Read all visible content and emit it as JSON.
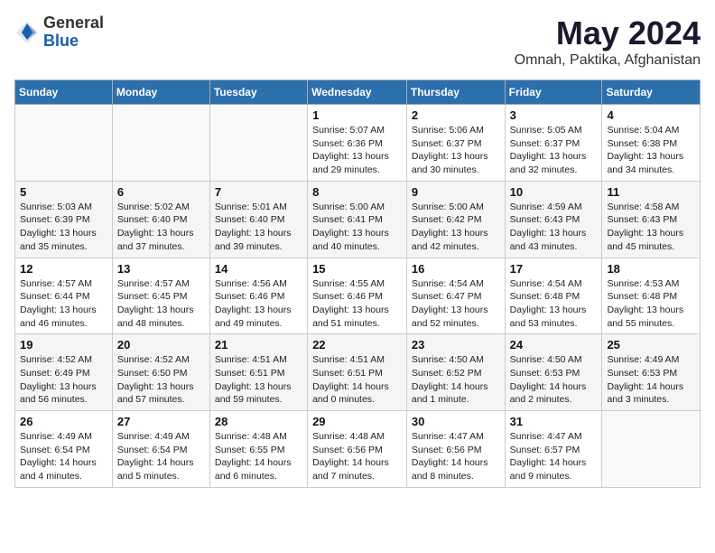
{
  "logo": {
    "general": "General",
    "blue": "Blue"
  },
  "title": "May 2024",
  "subtitle": "Omnah, Paktika, Afghanistan",
  "days_of_week": [
    "Sunday",
    "Monday",
    "Tuesday",
    "Wednesday",
    "Thursday",
    "Friday",
    "Saturday"
  ],
  "weeks": [
    [
      {
        "num": "",
        "info": ""
      },
      {
        "num": "",
        "info": ""
      },
      {
        "num": "",
        "info": ""
      },
      {
        "num": "1",
        "info": "Sunrise: 5:07 AM\nSunset: 6:36 PM\nDaylight: 13 hours\nand 29 minutes."
      },
      {
        "num": "2",
        "info": "Sunrise: 5:06 AM\nSunset: 6:37 PM\nDaylight: 13 hours\nand 30 minutes."
      },
      {
        "num": "3",
        "info": "Sunrise: 5:05 AM\nSunset: 6:37 PM\nDaylight: 13 hours\nand 32 minutes."
      },
      {
        "num": "4",
        "info": "Sunrise: 5:04 AM\nSunset: 6:38 PM\nDaylight: 13 hours\nand 34 minutes."
      }
    ],
    [
      {
        "num": "5",
        "info": "Sunrise: 5:03 AM\nSunset: 6:39 PM\nDaylight: 13 hours\nand 35 minutes."
      },
      {
        "num": "6",
        "info": "Sunrise: 5:02 AM\nSunset: 6:40 PM\nDaylight: 13 hours\nand 37 minutes."
      },
      {
        "num": "7",
        "info": "Sunrise: 5:01 AM\nSunset: 6:40 PM\nDaylight: 13 hours\nand 39 minutes."
      },
      {
        "num": "8",
        "info": "Sunrise: 5:00 AM\nSunset: 6:41 PM\nDaylight: 13 hours\nand 40 minutes."
      },
      {
        "num": "9",
        "info": "Sunrise: 5:00 AM\nSunset: 6:42 PM\nDaylight: 13 hours\nand 42 minutes."
      },
      {
        "num": "10",
        "info": "Sunrise: 4:59 AM\nSunset: 6:43 PM\nDaylight: 13 hours\nand 43 minutes."
      },
      {
        "num": "11",
        "info": "Sunrise: 4:58 AM\nSunset: 6:43 PM\nDaylight: 13 hours\nand 45 minutes."
      }
    ],
    [
      {
        "num": "12",
        "info": "Sunrise: 4:57 AM\nSunset: 6:44 PM\nDaylight: 13 hours\nand 46 minutes."
      },
      {
        "num": "13",
        "info": "Sunrise: 4:57 AM\nSunset: 6:45 PM\nDaylight: 13 hours\nand 48 minutes."
      },
      {
        "num": "14",
        "info": "Sunrise: 4:56 AM\nSunset: 6:46 PM\nDaylight: 13 hours\nand 49 minutes."
      },
      {
        "num": "15",
        "info": "Sunrise: 4:55 AM\nSunset: 6:46 PM\nDaylight: 13 hours\nand 51 minutes."
      },
      {
        "num": "16",
        "info": "Sunrise: 4:54 AM\nSunset: 6:47 PM\nDaylight: 13 hours\nand 52 minutes."
      },
      {
        "num": "17",
        "info": "Sunrise: 4:54 AM\nSunset: 6:48 PM\nDaylight: 13 hours\nand 53 minutes."
      },
      {
        "num": "18",
        "info": "Sunrise: 4:53 AM\nSunset: 6:48 PM\nDaylight: 13 hours\nand 55 minutes."
      }
    ],
    [
      {
        "num": "19",
        "info": "Sunrise: 4:52 AM\nSunset: 6:49 PM\nDaylight: 13 hours\nand 56 minutes."
      },
      {
        "num": "20",
        "info": "Sunrise: 4:52 AM\nSunset: 6:50 PM\nDaylight: 13 hours\nand 57 minutes."
      },
      {
        "num": "21",
        "info": "Sunrise: 4:51 AM\nSunset: 6:51 PM\nDaylight: 13 hours\nand 59 minutes."
      },
      {
        "num": "22",
        "info": "Sunrise: 4:51 AM\nSunset: 6:51 PM\nDaylight: 14 hours\nand 0 minutes."
      },
      {
        "num": "23",
        "info": "Sunrise: 4:50 AM\nSunset: 6:52 PM\nDaylight: 14 hours\nand 1 minute."
      },
      {
        "num": "24",
        "info": "Sunrise: 4:50 AM\nSunset: 6:53 PM\nDaylight: 14 hours\nand 2 minutes."
      },
      {
        "num": "25",
        "info": "Sunrise: 4:49 AM\nSunset: 6:53 PM\nDaylight: 14 hours\nand 3 minutes."
      }
    ],
    [
      {
        "num": "26",
        "info": "Sunrise: 4:49 AM\nSunset: 6:54 PM\nDaylight: 14 hours\nand 4 minutes."
      },
      {
        "num": "27",
        "info": "Sunrise: 4:49 AM\nSunset: 6:54 PM\nDaylight: 14 hours\nand 5 minutes."
      },
      {
        "num": "28",
        "info": "Sunrise: 4:48 AM\nSunset: 6:55 PM\nDaylight: 14 hours\nand 6 minutes."
      },
      {
        "num": "29",
        "info": "Sunrise: 4:48 AM\nSunset: 6:56 PM\nDaylight: 14 hours\nand 7 minutes."
      },
      {
        "num": "30",
        "info": "Sunrise: 4:47 AM\nSunset: 6:56 PM\nDaylight: 14 hours\nand 8 minutes."
      },
      {
        "num": "31",
        "info": "Sunrise: 4:47 AM\nSunset: 6:57 PM\nDaylight: 14 hours\nand 9 minutes."
      },
      {
        "num": "",
        "info": ""
      }
    ]
  ]
}
